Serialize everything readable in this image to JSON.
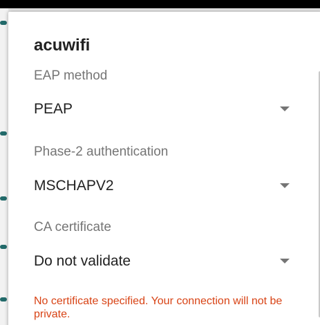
{
  "dialog": {
    "title": "acuwifi",
    "fields": {
      "eap_method": {
        "label": "EAP method",
        "value": "PEAP",
        "icon": "dropdown-arrow-icon"
      },
      "phase2_auth": {
        "label": "Phase-2 authentication",
        "value": "MSCHAPV2",
        "icon": "dropdown-arrow-icon"
      },
      "ca_certificate": {
        "label": "CA certificate",
        "value": "Do not validate",
        "icon": "dropdown-arrow-icon"
      }
    },
    "warning_text": "No certificate specified. Your connection will not be private."
  },
  "colors": {
    "warning": "#d84315",
    "label": "#757575",
    "text": "#212121",
    "background": "#ffffff"
  }
}
